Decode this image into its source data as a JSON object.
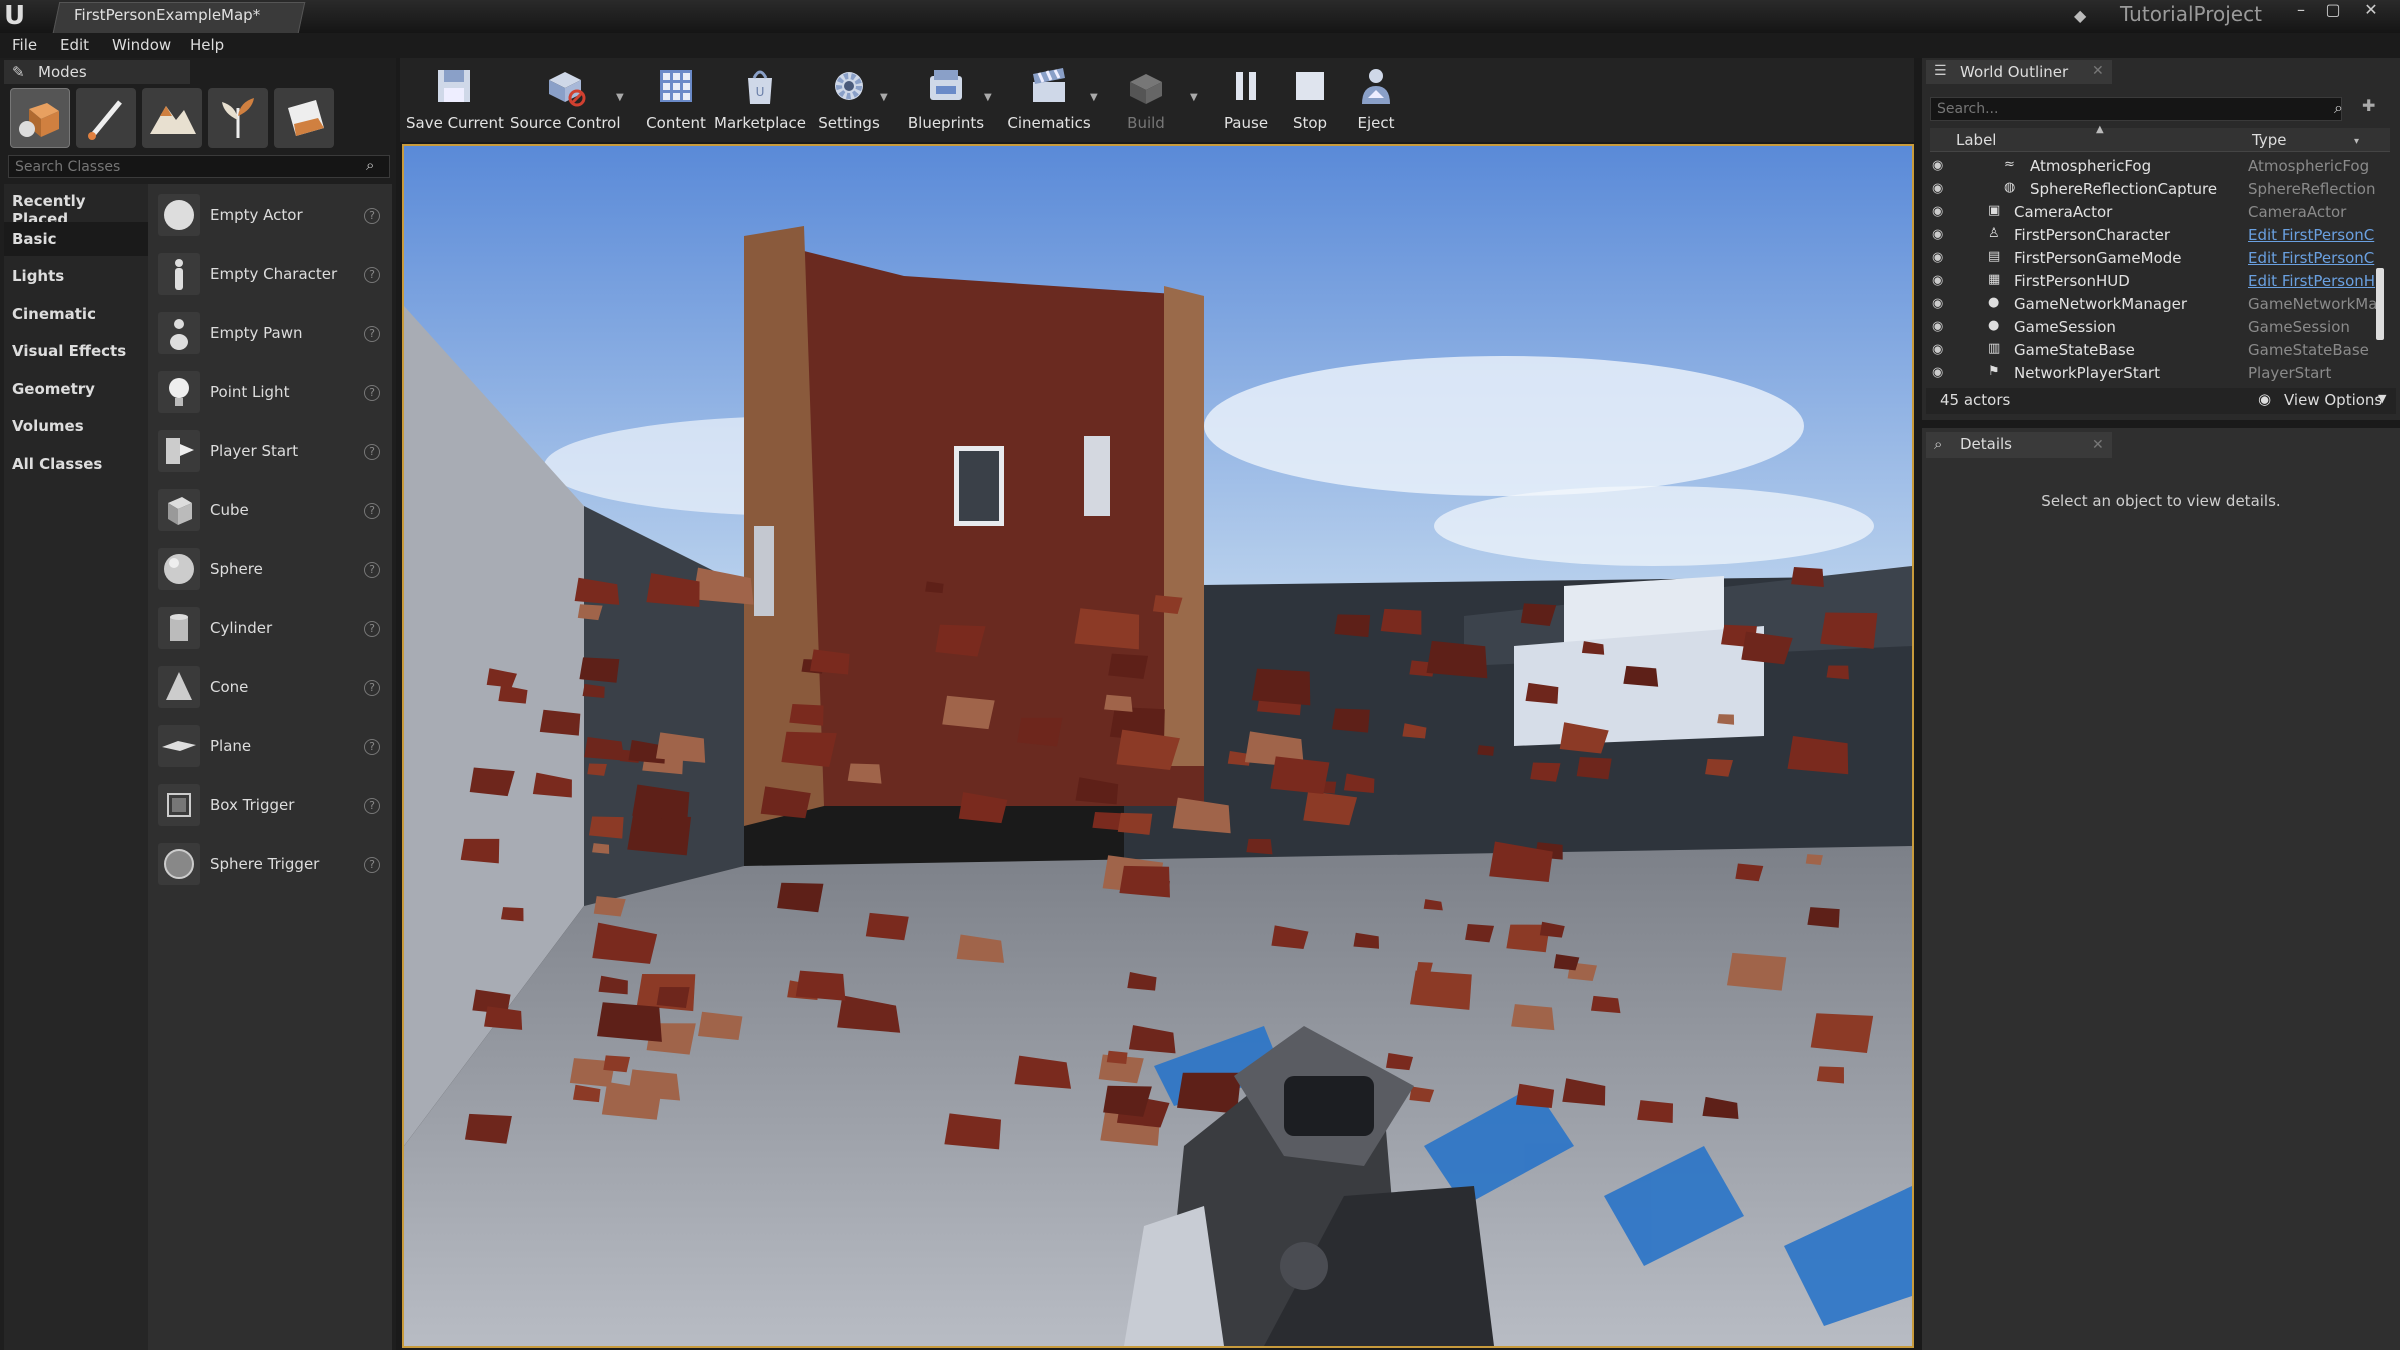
{
  "window": {
    "doc_tab": "FirstPersonExampleMap*",
    "project": "TutorialProject",
    "controls": [
      "–",
      "▢",
      "✕"
    ]
  },
  "menu": [
    "File",
    "Edit",
    "Window",
    "Help"
  ],
  "modes": {
    "title": "Modes",
    "search_placeholder": "Search Classes",
    "categories": [
      "Recently Placed",
      "Basic",
      "Lights",
      "Cinematic",
      "Visual Effects",
      "Geometry",
      "Volumes",
      "All Classes"
    ],
    "active_category": "Basic",
    "items": [
      "Empty Actor",
      "Empty Character",
      "Empty Pawn",
      "Point Light",
      "Player Start",
      "Cube",
      "Sphere",
      "Cylinder",
      "Cone",
      "Plane",
      "Box Trigger",
      "Sphere Trigger"
    ],
    "help_glyph": "?"
  },
  "toolbar": {
    "save": "Save Current",
    "source_control": "Source Control",
    "content": "Content",
    "marketplace": "Marketplace",
    "settings": "Settings",
    "blueprints": "Blueprints",
    "cinematics": "Cinematics",
    "build": "Build",
    "pause": "Pause",
    "stop": "Stop",
    "eject": "Eject"
  },
  "outliner": {
    "title": "World Outliner",
    "search_placeholder": "Search...",
    "col_label": "Label",
    "col_type": "Type",
    "rows": [
      {
        "label": "AtmosphericFog",
        "type": "AtmosphericFog",
        "link": false
      },
      {
        "label": "SphereReflectionCapture",
        "type": "SphereReflectionC",
        "link": false
      },
      {
        "label": "CameraActor",
        "type": "CameraActor",
        "link": false
      },
      {
        "label": "FirstPersonCharacter",
        "type": "Edit FirstPersonC",
        "link": true
      },
      {
        "label": "FirstPersonGameMode",
        "type": "Edit FirstPersonC",
        "link": true
      },
      {
        "label": "FirstPersonHUD",
        "type": "Edit FirstPersonH",
        "link": true
      },
      {
        "label": "GameNetworkManager",
        "type": "GameNetworkMar",
        "link": false
      },
      {
        "label": "GameSession",
        "type": "GameSession",
        "link": false
      },
      {
        "label": "GameStateBase",
        "type": "GameStateBase",
        "link": false
      },
      {
        "label": "NetworkPlayerStart",
        "type": "PlayerStart",
        "link": false
      }
    ],
    "actor_count": "45 actors",
    "view_options": "View Options"
  },
  "details": {
    "title": "Details",
    "message": "Select an object to view details."
  },
  "colors": {
    "viewport_border": "#c89b3c",
    "link": "#6aa0e0",
    "brick": "#7a2a1e",
    "floor": "#9aa0a8",
    "sky": "#8fb8e8"
  }
}
